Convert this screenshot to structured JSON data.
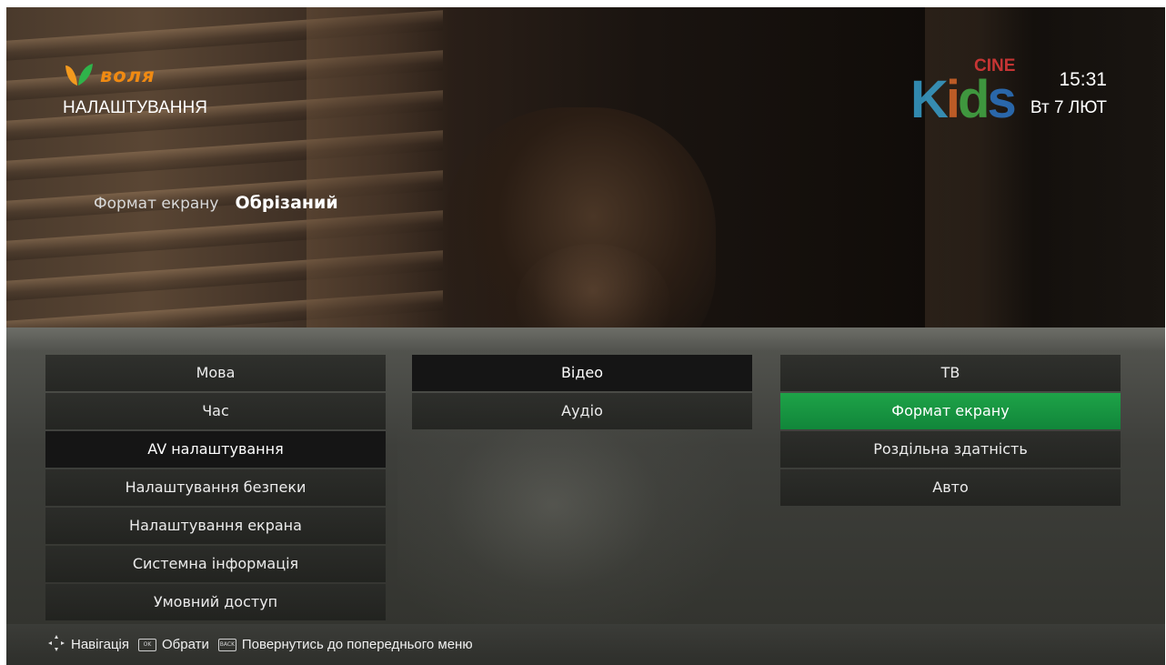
{
  "header": {
    "brand_name": "воля",
    "title": "НАЛАШТУВАННЯ",
    "clock_time": "15:31",
    "clock_date": "Вт 7 ЛЮТ",
    "channel_logo": {
      "name": "Kids",
      "sub": "CINE"
    }
  },
  "preview": {
    "label": "Формат екрану",
    "value": "Обрізаний"
  },
  "menu": {
    "main": [
      {
        "label": "Мова",
        "state": "normal"
      },
      {
        "label": "Час",
        "state": "normal"
      },
      {
        "label": "AV налаштування",
        "state": "active"
      },
      {
        "label": "Налаштування безпеки",
        "state": "normal"
      },
      {
        "label": "Налаштування екрана",
        "state": "normal"
      },
      {
        "label": "Системна інформація",
        "state": "normal"
      },
      {
        "label": "Умовний доступ",
        "state": "normal"
      }
    ],
    "av": [
      {
        "label": "Відео",
        "state": "active"
      },
      {
        "label": "Аудіо",
        "state": "normal"
      }
    ],
    "tv": [
      {
        "label": "ТВ",
        "state": "normal"
      },
      {
        "label": "Формат екрану",
        "state": "highlight"
      },
      {
        "label": "Роздільна здатність",
        "state": "normal"
      },
      {
        "label": "Авто",
        "state": "normal"
      }
    ]
  },
  "footer": {
    "nav_icon": "dpad-icon",
    "nav_label": "Навігація",
    "ok_icon": "ok-button-icon",
    "ok_label": "Обрати",
    "back_icon": "back-button-icon",
    "back_label": "Повернутись до попереднього меню"
  },
  "colors": {
    "highlight": "#1ea348",
    "brand": "#f08a12"
  }
}
